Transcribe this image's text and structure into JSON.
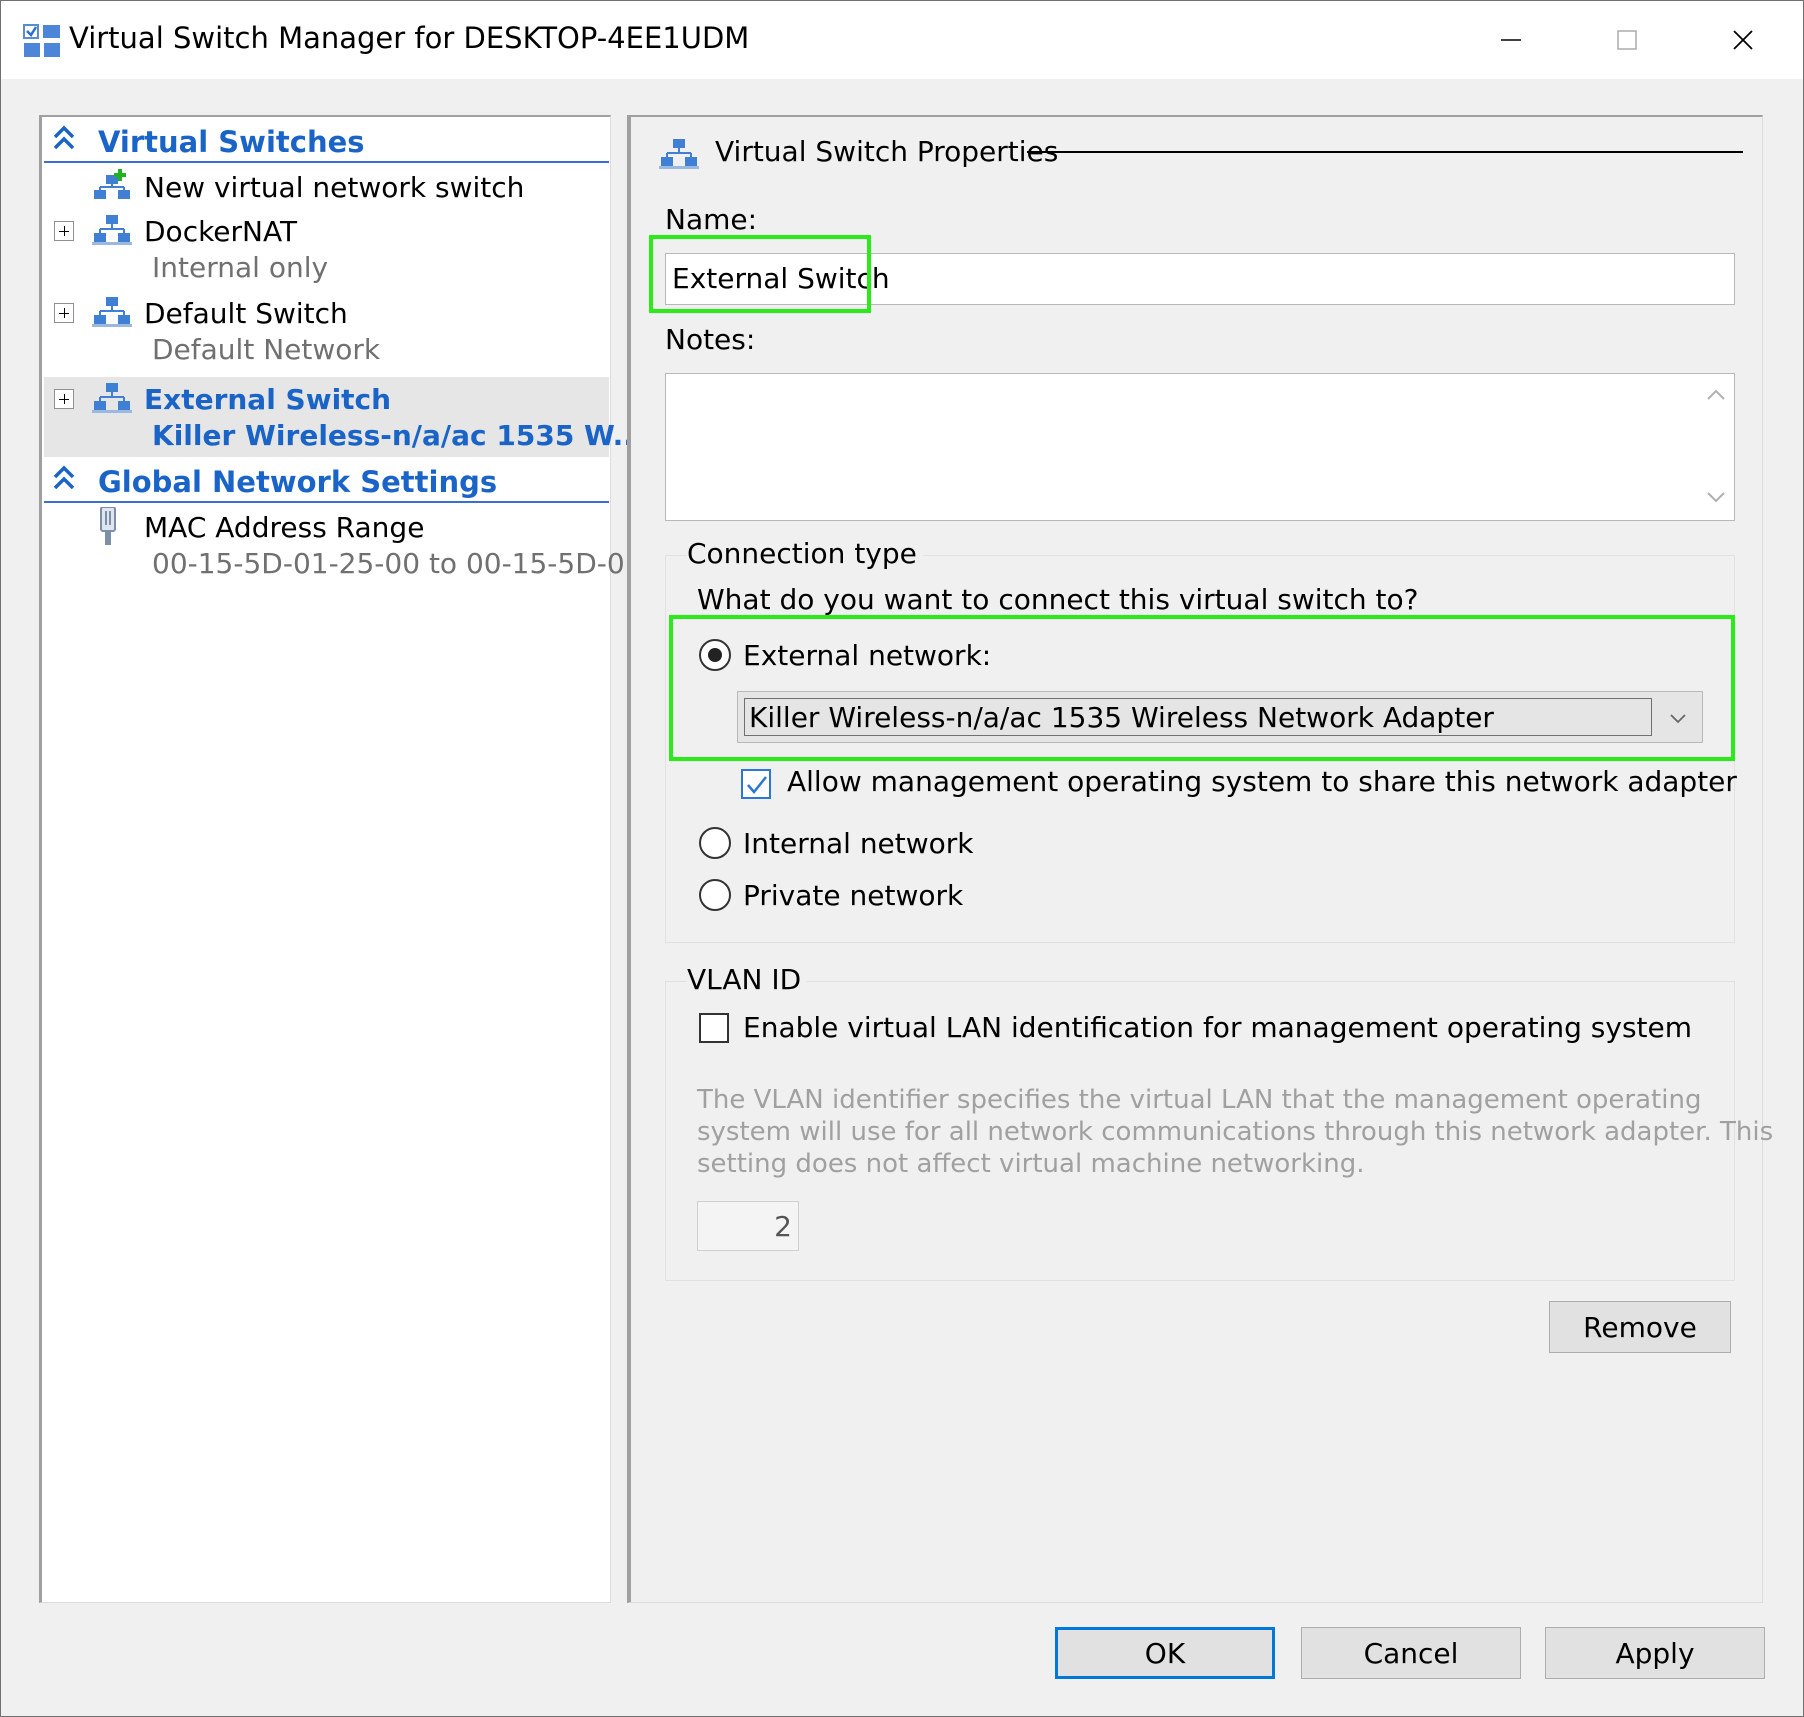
{
  "window": {
    "title": "Virtual Switch Manager for DESKTOP-4EE1UDM"
  },
  "sidebar": {
    "virtual_switches": {
      "header": "Virtual Switches",
      "items": [
        {
          "label": "New virtual network switch"
        },
        {
          "label": "DockerNAT",
          "sub": "Internal only"
        },
        {
          "label": "Default Switch",
          "sub": "Default Network"
        },
        {
          "label": "External Switch",
          "sub": "Killer Wireless-n/a/ac 1535 W..."
        }
      ]
    },
    "global_settings": {
      "header": "Global Network Settings",
      "items": [
        {
          "label": "MAC Address Range",
          "sub": "00-15-5D-01-25-00 to 00-15-5D-0..."
        }
      ]
    }
  },
  "properties": {
    "heading": "Virtual Switch Properties",
    "name_label": "Name:",
    "name_value": "External Switch",
    "notes_label": "Notes:",
    "notes_value": "",
    "connection": {
      "group_label": "Connection type",
      "question": "What do you want to connect this virtual switch to?",
      "external_label": "External network:",
      "adapter_selected": "Killer Wireless-n/a/ac 1535 Wireless Network Adapter",
      "allow_share_label": "Allow management operating system to share this network adapter",
      "internal_label": "Internal network",
      "private_label": "Private network"
    },
    "vlan": {
      "group_label": "VLAN ID",
      "enable_label": "Enable virtual LAN identification for management operating system",
      "description_1": "The VLAN identifier specifies the virtual LAN that the management operating",
      "description_2": "system will use for all network communications through this network adapter. This",
      "description_3": "setting does not affect virtual machine networking.",
      "id_value": "2"
    },
    "remove_label": "Remove"
  },
  "footer": {
    "ok_label": "OK",
    "cancel_label": "Cancel",
    "apply_label": "Apply"
  },
  "colors": {
    "accent_blue": "#1a64c8",
    "highlight_green": "#2bea1a",
    "default_button_border": "#0078d7"
  }
}
